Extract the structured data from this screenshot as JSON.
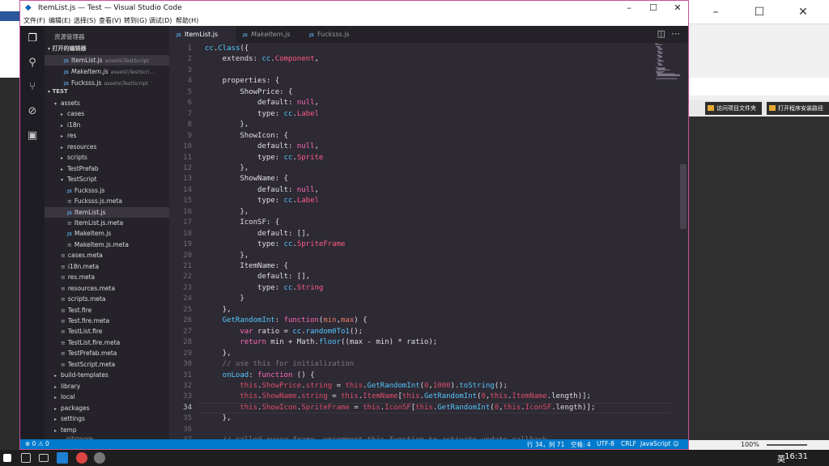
{
  "window": {
    "title": "ItemList.js — Test — Visual Studio Code"
  },
  "menu": [
    "文件(F)",
    "编辑(E)",
    "选择(S)",
    "查看(V)",
    "转到(G)",
    "调试(D)",
    "帮助(H)"
  ],
  "sidebar": {
    "header": "资源管理器",
    "open_editors_label": "打开的编辑器",
    "open_editors": [
      {
        "name": "ItemList.js",
        "desc": "assets\\TestScript"
      },
      {
        "name": "MakeItem.js",
        "desc": "assets\\TestScri..."
      },
      {
        "name": "Fucksss.js",
        "desc": "assets\\TestScript"
      }
    ],
    "project_label": "TEST",
    "tree": [
      {
        "label": "assets",
        "type": "folder-open"
      },
      {
        "label": "cases",
        "type": "folder"
      },
      {
        "label": "i18n",
        "type": "folder"
      },
      {
        "label": "res",
        "type": "folder"
      },
      {
        "label": "resources",
        "type": "folder"
      },
      {
        "label": "scripts",
        "type": "folder"
      },
      {
        "label": "TestPrefab",
        "type": "folder"
      },
      {
        "label": "TestScript",
        "type": "folder-open"
      },
      {
        "label": "Fucksss.js",
        "type": "js"
      },
      {
        "label": "Fucksss.js.meta",
        "type": "meta"
      },
      {
        "label": "ItemList.js",
        "type": "js"
      },
      {
        "label": "ItemList.js.meta",
        "type": "meta"
      },
      {
        "label": "MakeItem.js",
        "type": "js"
      },
      {
        "label": "MakeItem.js.meta",
        "type": "meta"
      },
      {
        "label": "cases.meta",
        "type": "meta"
      },
      {
        "label": "i18n.meta",
        "type": "meta"
      },
      {
        "label": "res.meta",
        "type": "meta"
      },
      {
        "label": "resources.meta",
        "type": "meta"
      },
      {
        "label": "scripts.meta",
        "type": "meta"
      },
      {
        "label": "Test.fire",
        "type": "meta"
      },
      {
        "label": "Test.fire.meta",
        "type": "meta"
      },
      {
        "label": "TestList.fire",
        "type": "meta"
      },
      {
        "label": "TestList.fire.meta",
        "type": "meta"
      },
      {
        "label": "TestPrefab.meta",
        "type": "meta"
      },
      {
        "label": "TestScript.meta",
        "type": "meta"
      },
      {
        "label": "build-templates",
        "type": "folder"
      },
      {
        "label": "library",
        "type": "folder"
      },
      {
        "label": "local",
        "type": "folder"
      },
      {
        "label": "packages",
        "type": "folder"
      },
      {
        "label": "settings",
        "type": "folder"
      },
      {
        "label": "temp",
        "type": "folder"
      }
    ]
  },
  "tabs": [
    {
      "label": "ItemList.js",
      "active": true,
      "italic": false
    },
    {
      "label": "MakeItem.js",
      "active": false,
      "italic": true
    },
    {
      "label": "Fucksss.js",
      "active": false,
      "italic": false
    }
  ],
  "editor": {
    "start_line": 1,
    "current_line": 34,
    "lines": [
      [
        [
          "cc",
          "f"
        ],
        [
          ".",
          "y"
        ],
        [
          "Class",
          "f"
        ],
        [
          "({",
          "y"
        ]
      ],
      [
        [
          "    extends",
          "y"
        ],
        [
          ": ",
          "y"
        ],
        [
          "cc",
          "f"
        ],
        [
          ".",
          "y"
        ],
        [
          "Component",
          "s"
        ],
        [
          ",",
          "y"
        ]
      ],
      [],
      [
        [
          "    properties",
          "y"
        ],
        [
          ": {",
          "y"
        ]
      ],
      [
        [
          "        ShowPrice",
          "y"
        ],
        [
          ": {",
          "y"
        ]
      ],
      [
        [
          "            default",
          "y"
        ],
        [
          ": ",
          "y"
        ],
        [
          "null",
          "p"
        ],
        [
          ",",
          "y"
        ]
      ],
      [
        [
          "            type",
          "y"
        ],
        [
          ": ",
          "y"
        ],
        [
          "cc",
          "f"
        ],
        [
          ".",
          "y"
        ],
        [
          "Label",
          "s"
        ]
      ],
      [
        [
          "        },",
          "y"
        ]
      ],
      [
        [
          "        ShowIcon",
          "y"
        ],
        [
          ": {",
          "y"
        ]
      ],
      [
        [
          "            default",
          "y"
        ],
        [
          ": ",
          "y"
        ],
        [
          "null",
          "p"
        ],
        [
          ",",
          "y"
        ]
      ],
      [
        [
          "            type",
          "y"
        ],
        [
          ": ",
          "y"
        ],
        [
          "cc",
          "f"
        ],
        [
          ".",
          "y"
        ],
        [
          "Sprite",
          "s"
        ]
      ],
      [
        [
          "        },",
          "y"
        ]
      ],
      [
        [
          "        ShowName",
          "y"
        ],
        [
          ": {",
          "y"
        ]
      ],
      [
        [
          "            default",
          "y"
        ],
        [
          ": ",
          "y"
        ],
        [
          "null",
          "p"
        ],
        [
          ",",
          "y"
        ]
      ],
      [
        [
          "            type",
          "y"
        ],
        [
          ": ",
          "y"
        ],
        [
          "cc",
          "f"
        ],
        [
          ".",
          "y"
        ],
        [
          "Label",
          "s"
        ]
      ],
      [
        [
          "        },",
          "y"
        ]
      ],
      [
        [
          "        IconSF",
          "y"
        ],
        [
          ": {",
          "y"
        ]
      ],
      [
        [
          "            default",
          "y"
        ],
        [
          ": [],",
          "y"
        ]
      ],
      [
        [
          "            type",
          "y"
        ],
        [
          ": ",
          "y"
        ],
        [
          "cc",
          "f"
        ],
        [
          ".",
          "y"
        ],
        [
          "SpriteFrame",
          "s"
        ]
      ],
      [
        [
          "        },",
          "y"
        ]
      ],
      [
        [
          "        ItemName",
          "y"
        ],
        [
          ": {",
          "y"
        ]
      ],
      [
        [
          "            default",
          "y"
        ],
        [
          ": [],",
          "y"
        ]
      ],
      [
        [
          "            type",
          "y"
        ],
        [
          ": ",
          "y"
        ],
        [
          "cc",
          "f"
        ],
        [
          ".",
          "y"
        ],
        [
          "String",
          "s"
        ]
      ],
      [
        [
          "        }",
          "y"
        ]
      ],
      [
        [
          "    },",
          "y"
        ]
      ],
      [
        [
          "    GetRandomInt",
          "f"
        ],
        [
          ": ",
          "y"
        ],
        [
          "function",
          "k"
        ],
        [
          "(",
          "y"
        ],
        [
          "min",
          "o"
        ],
        [
          ",",
          "y"
        ],
        [
          "max",
          "o"
        ],
        [
          ") {",
          "y"
        ]
      ],
      [
        [
          "        var",
          "k"
        ],
        [
          " ratio = ",
          "y"
        ],
        [
          "cc",
          "f"
        ],
        [
          ".",
          "y"
        ],
        [
          "random0To1",
          "f"
        ],
        [
          "();",
          "y"
        ]
      ],
      [
        [
          "        return",
          "k"
        ],
        [
          " min + Math.",
          "y"
        ],
        [
          "floor",
          "f"
        ],
        [
          "((max - min) * ratio);",
          "y"
        ]
      ],
      [
        [
          "    },",
          "y"
        ]
      ],
      [
        [
          "    // use this for initialization",
          "c"
        ]
      ],
      [
        [
          "    onLoad",
          "f"
        ],
        [
          ": ",
          "y"
        ],
        [
          "function",
          "k"
        ],
        [
          " () {",
          "y"
        ]
      ],
      [
        [
          "        this",
          "g"
        ],
        [
          ".",
          "y"
        ],
        [
          "ShowPrice",
          "g"
        ],
        [
          ".",
          "y"
        ],
        [
          "string",
          "g"
        ],
        [
          " = ",
          "y"
        ],
        [
          "this",
          "g"
        ],
        [
          ".",
          "y"
        ],
        [
          "GetRandomInt",
          "f"
        ],
        [
          "(",
          "y"
        ],
        [
          "0",
          "g"
        ],
        [
          ",",
          "y"
        ],
        [
          "1000",
          "g"
        ],
        [
          ").",
          "y"
        ],
        [
          "toString",
          "f"
        ],
        [
          "();",
          "y"
        ]
      ],
      [
        [
          "        this",
          "g"
        ],
        [
          ".",
          "y"
        ],
        [
          "ShowName",
          "g"
        ],
        [
          ".",
          "y"
        ],
        [
          "string",
          "g"
        ],
        [
          " = ",
          "y"
        ],
        [
          "this",
          "g"
        ],
        [
          ".",
          "y"
        ],
        [
          "ItemName",
          "g"
        ],
        [
          "[",
          "y"
        ],
        [
          "this",
          "g"
        ],
        [
          ".",
          "y"
        ],
        [
          "GetRandomInt",
          "f"
        ],
        [
          "(",
          "y"
        ],
        [
          "0",
          "g"
        ],
        [
          ",",
          "y"
        ],
        [
          "this",
          "g"
        ],
        [
          ".",
          "y"
        ],
        [
          "ItemName",
          "g"
        ],
        [
          ".length)];",
          "y"
        ]
      ],
      [
        [
          "        this",
          "g"
        ],
        [
          ".",
          "y"
        ],
        [
          "ShowIcon",
          "g"
        ],
        [
          ".",
          "y"
        ],
        [
          "SpriteFrame",
          "g"
        ],
        [
          " = ",
          "y"
        ],
        [
          "this",
          "g"
        ],
        [
          ".",
          "y"
        ],
        [
          "IconSF",
          "g"
        ],
        [
          "[",
          "y"
        ],
        [
          "this",
          "g"
        ],
        [
          ".",
          "y"
        ],
        [
          "GetRandomInt",
          "f"
        ],
        [
          "(",
          "y"
        ],
        [
          "0",
          "g"
        ],
        [
          ",",
          "y"
        ],
        [
          "this",
          "g"
        ],
        [
          ".",
          "y"
        ],
        [
          "IconSF",
          "g"
        ],
        [
          ".length)];",
          "y"
        ]
      ],
      [
        [
          "    },",
          "y"
        ]
      ],
      [],
      [
        [
          "    // called every frame, uncomment this function to activate update callback",
          "c"
        ]
      ]
    ]
  },
  "status": {
    "errors": "0",
    "warnings": "0",
    "position": "行 34，列 71",
    "spaces": "空格: 4",
    "encoding": "UTF-8",
    "eol": "CRLF",
    "language": "JavaScript"
  },
  "bg": {
    "btn1": "访问项目文件夹",
    "btn2": "打开程序安装路径",
    "zoom": "100%"
  },
  "taskbar": {
    "lang": "英",
    "time": "16:31"
  },
  "colors": {
    "accent": "#007acc",
    "border": "#c2529a",
    "editor_bg": "#2d2a34"
  }
}
